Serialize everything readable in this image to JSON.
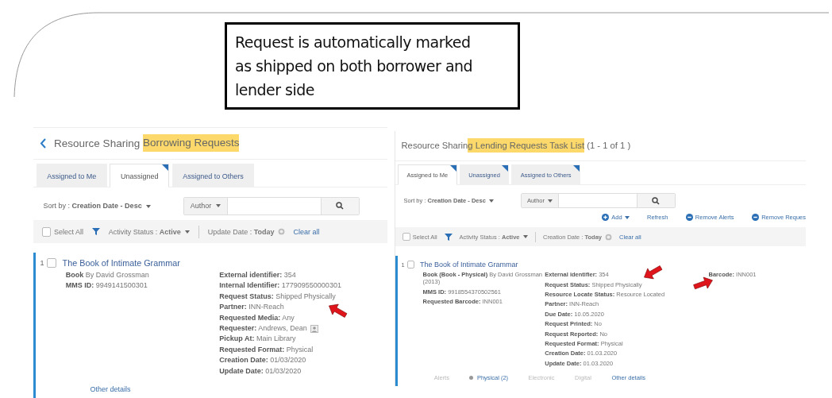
{
  "callout": {
    "text": "Request is automatically marked as shipped on both borrower and lender side"
  },
  "panels": [
    {
      "back": true,
      "title": {
        "before": "Resource Sharing ",
        "highlighted": "Borrowing Requests"
      },
      "tabs": [
        {
          "label": "Assigned to Me",
          "selected": false,
          "flagged": false
        },
        {
          "label": "Unassigned",
          "selected": true,
          "flagged": true
        },
        {
          "label": "Assigned to Others",
          "selected": false,
          "flagged": false
        }
      ],
      "sort": "Sort by : **Creation Date - Desc**",
      "search": {
        "scope": "Author"
      },
      "filter": {
        "select_all": {
          "label": "Select All",
          "checked": false
        },
        "chips": [
          {
            "text": "Activity Status : **Active**",
            "kind": "dropdown"
          },
          {
            "text": "Update Date : **Today**",
            "kind": "clearable"
          }
        ],
        "clear": "Clear all"
      },
      "item": {
        "index": "1",
        "checked": false,
        "title": "The Book of Intimate Grammar",
        "columns": [
          [
            {
              "label": "Book",
              "value": "By David Grossman",
              "kind": "text"
            },
            {
              "label": "MMS ID:",
              "value": "9949141500301",
              "kind": "text"
            }
          ],
          [
            {
              "label": "External identifier:",
              "value": "354",
              "kind": "text"
            },
            {
              "label": "Internal Identifier:",
              "value": "177909550000301",
              "kind": "text"
            },
            {
              "label": "Request Status:",
              "value": "Shipped Physically",
              "kind": "text"
            },
            {
              "label": "Partner:",
              "value": "INN-Reach",
              "kind": "text"
            },
            {
              "label": "Requested Media:",
              "value": "Any",
              "kind": "text"
            },
            {
              "label": "Requester:",
              "value": "Andrews, Dean",
              "kind": "person"
            },
            {
              "label": "Pickup At:",
              "value": "Main Library",
              "kind": "text"
            },
            {
              "label": "Requested Format:",
              "value": "Physical",
              "kind": "text"
            },
            {
              "label": "Creation Date:",
              "value": "01/03/2020",
              "kind": "text"
            },
            {
              "label": "Update Date:",
              "value": "01/03/2020",
              "kind": "text"
            }
          ]
        ],
        "links": [
          {
            "label": "Other details",
            "disabled": false,
            "marked": false
          }
        ]
      }
    },
    {
      "back": false,
      "title": {
        "before": "Resource Sharin",
        "highlighted": "g Lending Requests Task List",
        "after": " (1 - 1 of 1 )"
      },
      "tabs": [
        {
          "label": "Assigned to Me",
          "selected": true,
          "flagged": true
        },
        {
          "label": "Unassigned",
          "selected": false,
          "flagged": true
        },
        {
          "label": "Assigned to Others",
          "selected": false,
          "flagged": true
        }
      ],
      "sort": "Sort by : **Creation Date - Desc**",
      "search": {
        "scope": "Author"
      },
      "actions": [
        {
          "label": "Add",
          "kind": "add",
          "menu": true
        },
        {
          "label": "Refresh",
          "kind": "plain",
          "menu": false
        },
        {
          "label": "Remove Alerts",
          "kind": "remove",
          "menu": false
        },
        {
          "label": "Remove Reques",
          "kind": "remove",
          "menu": false
        }
      ],
      "filter": {
        "select_all": {
          "label": "Select All",
          "checked": false
        },
        "chips": [
          {
            "text": "Activity Status : **Active**",
            "kind": "dropdown"
          },
          {
            "text": "Creation Date : **Today**",
            "kind": "clearable"
          }
        ],
        "clear": "Clear all"
      },
      "item": {
        "index": "1",
        "checked": false,
        "title": "The Book of Intimate Grammar",
        "columns": [
          [
            {
              "label": "Book (Book - Physical)",
              "value": "By David Grossman (2013)",
              "kind": "text"
            },
            {
              "label": "MMS ID:",
              "value": "9918554370502561",
              "kind": "text"
            },
            {
              "label": "Requested Barcode:",
              "value": "INN001",
              "kind": "text"
            }
          ],
          [
            {
              "label": "External identifier:",
              "value": "354",
              "kind": "text"
            },
            {
              "label": "Request Status:",
              "value": "Shipped Physically",
              "kind": "text"
            },
            {
              "label": "Resource Locate Status:",
              "value": "Resource Located",
              "kind": "text"
            },
            {
              "label": "Partner:",
              "value": "INN-Reach",
              "kind": "text"
            },
            {
              "label": "Due Date:",
              "value": "10.05.2020",
              "kind": "text"
            },
            {
              "label": "Request Printed:",
              "value": "No",
              "kind": "text"
            },
            {
              "label": "Request Reported:",
              "value": "No",
              "kind": "text"
            },
            {
              "label": "Requested Format:",
              "value": "Physical",
              "kind": "text"
            },
            {
              "label": "Creation Date:",
              "value": "01.03.2020",
              "kind": "text"
            },
            {
              "label": "Update Date:",
              "value": "01.03.2020",
              "kind": "text"
            }
          ],
          [
            {
              "label": "Barcode:",
              "value": "INN001",
              "kind": "text"
            }
          ]
        ],
        "links": [
          {
            "label": "Alerts",
            "disabled": true,
            "marked": false
          },
          {
            "label": "Physical (2)",
            "disabled": false,
            "marked": true
          },
          {
            "label": "Electronic",
            "disabled": true,
            "marked": false
          },
          {
            "label": "Digital",
            "disabled": true,
            "marked": false
          },
          {
            "label": "Other details",
            "disabled": false,
            "marked": false
          }
        ]
      }
    }
  ]
}
